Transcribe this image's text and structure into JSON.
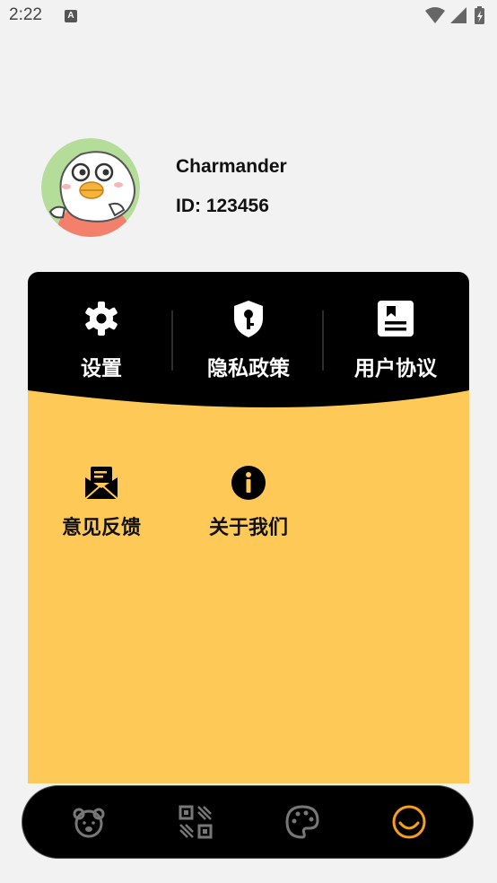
{
  "status_bar": {
    "time": "2:22",
    "notification_letter": "A"
  },
  "profile": {
    "name": "Charmander",
    "id_text": "ID: 123456"
  },
  "top_menu": [
    {
      "label": "设置",
      "icon": "gear-icon"
    },
    {
      "label": "隐私政策",
      "icon": "shield-key-icon"
    },
    {
      "label": "用户协议",
      "icon": "document-icon"
    }
  ],
  "grid_menu": [
    {
      "label": "意见反馈",
      "icon": "mail-icon"
    },
    {
      "label": "关于我们",
      "icon": "info-icon"
    }
  ],
  "bottom_nav": [
    {
      "name": "bear-icon",
      "active": false
    },
    {
      "name": "qr-icon",
      "active": false
    },
    {
      "name": "palette-icon",
      "active": false
    },
    {
      "name": "smile-icon",
      "active": true
    }
  ],
  "colors": {
    "accent": "#f6a01a",
    "card_yellow": "#fec956",
    "dark": "#000000"
  }
}
